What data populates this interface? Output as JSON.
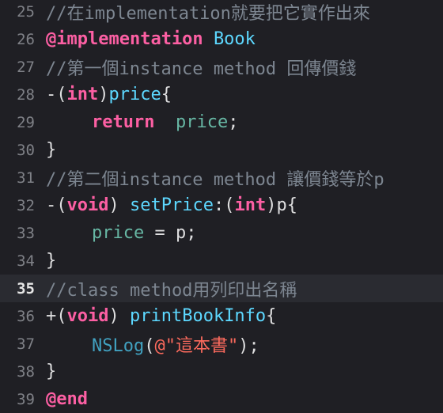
{
  "editor": {
    "current_line_number": "35",
    "lines": [
      {
        "number": "25",
        "tokens": [
          "//在implementation就要把它實作出來"
        ]
      },
      {
        "number": "26",
        "tokens": [
          "@implementation",
          " ",
          "Book"
        ]
      },
      {
        "number": "27",
        "tokens": [
          "//第一個instance method 回傳價錢"
        ]
      },
      {
        "number": "28",
        "tokens": [
          "-(",
          "int",
          ")",
          "price",
          "{"
        ]
      },
      {
        "number": "29",
        "tokens": [
          "return",
          "  ",
          "price",
          ";"
        ]
      },
      {
        "number": "30",
        "tokens": [
          "}"
        ]
      },
      {
        "number": "31",
        "tokens": [
          "//第二個instance method 讓價錢等於p"
        ]
      },
      {
        "number": "32",
        "tokens": [
          "-(",
          "void",
          ") ",
          "setPrice",
          ":(",
          "int",
          ")p{"
        ]
      },
      {
        "number": "33",
        "tokens": [
          "price",
          " = p;"
        ]
      },
      {
        "number": "34",
        "tokens": [
          "}"
        ]
      },
      {
        "number": "35",
        "tokens": [
          "//class method用列印出名稱"
        ]
      },
      {
        "number": "36",
        "tokens": [
          "+(",
          "void",
          ") ",
          "printBookInfo",
          "{"
        ]
      },
      {
        "number": "37",
        "tokens": [
          "NSLog",
          "(",
          "@\"這本書\"",
          ");"
        ]
      },
      {
        "number": "38",
        "tokens": [
          "}"
        ]
      },
      {
        "number": "39",
        "tokens": [
          "@end"
        ]
      }
    ]
  },
  "colors": {
    "background": "#1f1f24",
    "current_line": "#2a2b31",
    "line_number": "#7f8187",
    "comment": "#7d8691",
    "keyword": "#fc5fa3",
    "type_name": "#5dd8ff",
    "identifier": "#67b7a4",
    "method_call": "#41a1c0",
    "string": "#fc6a5d",
    "plain": "#dfdfe0"
  }
}
